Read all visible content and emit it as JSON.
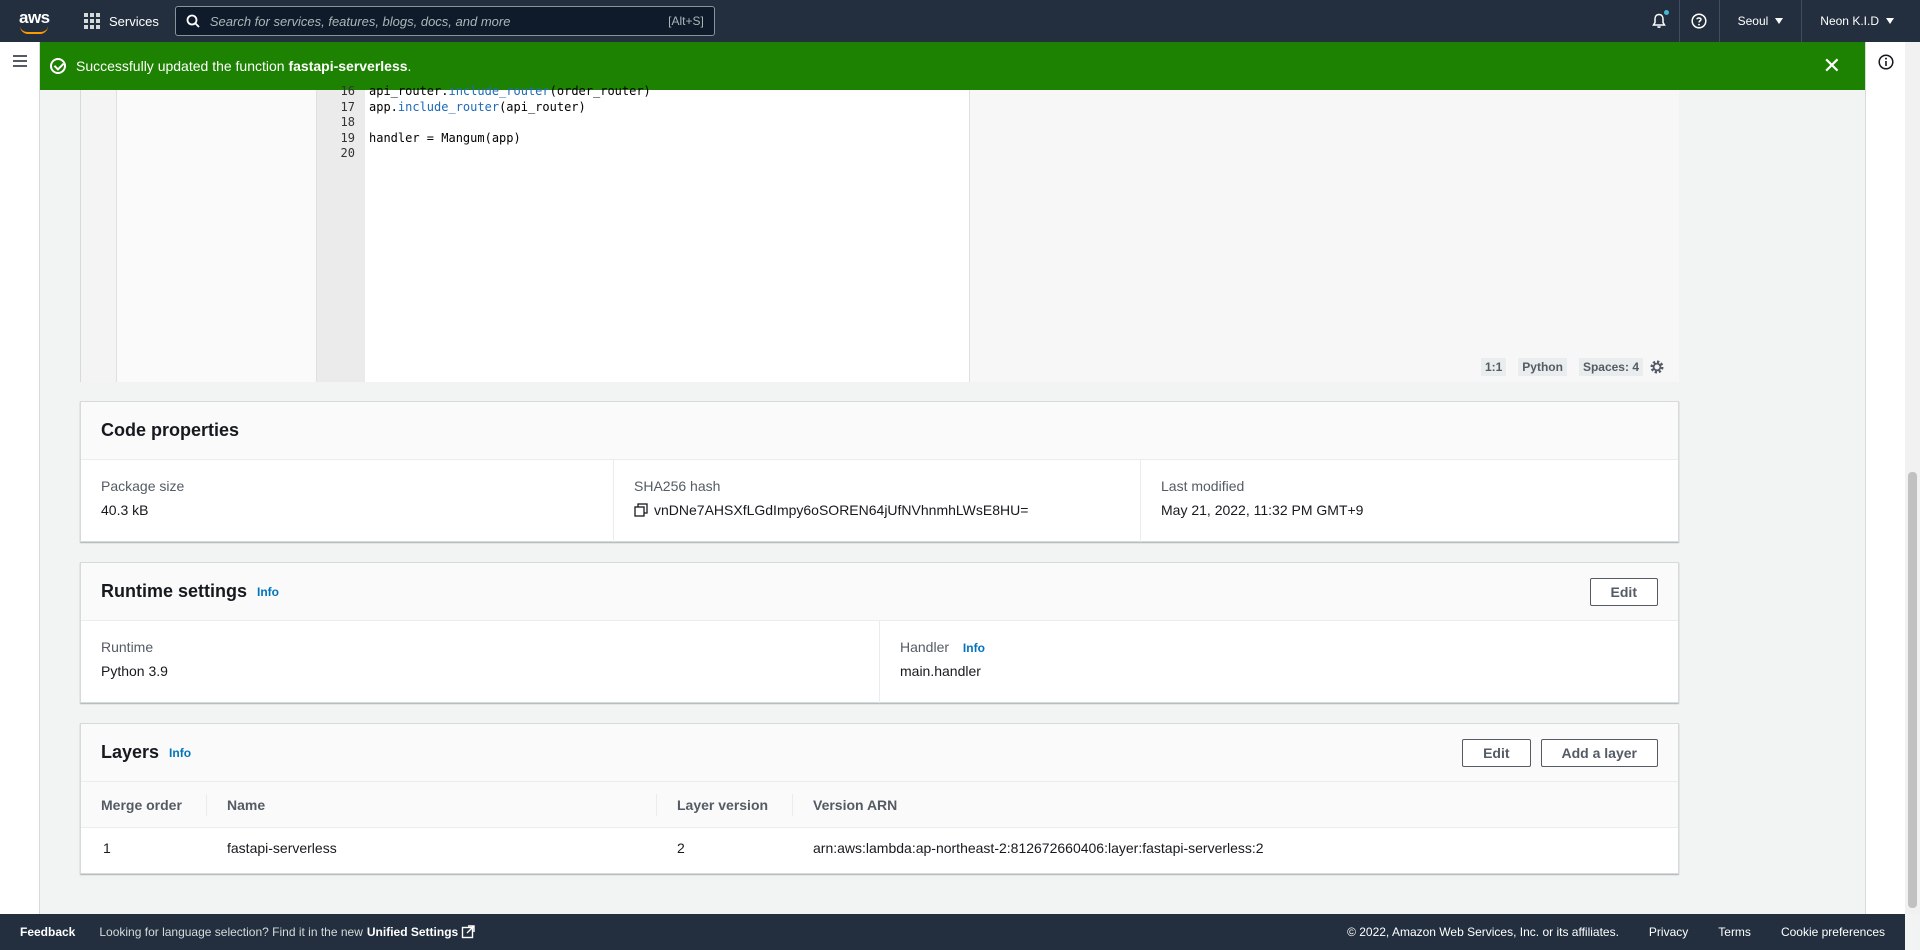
{
  "topnav": {
    "logo_text": "aws",
    "services_label": "Services",
    "search_placeholder": "Search for services, features, blogs, docs, and more",
    "search_shortcut": "[Alt+S]",
    "region_label": "Seoul",
    "account_label": "Neon K.I.D"
  },
  "flash": {
    "message_prefix": "Successfully updated the function ",
    "function_name": "fastapi-serverless",
    "message_suffix": ".",
    "color": "#1d8102"
  },
  "editor": {
    "line_numbers": [
      "16",
      "17",
      "18",
      "19",
      "20"
    ],
    "lines": [
      {
        "pre": "api_router.",
        "fn": "include_router",
        "post": "(order_router)"
      },
      {
        "pre": "app.",
        "fn": "include_router",
        "post": "(api_router)"
      },
      {
        "pre": "",
        "fn": "",
        "post": ""
      },
      {
        "pre": "handler = Mangum(app)",
        "fn": "",
        "post": ""
      },
      {
        "pre": "",
        "fn": "",
        "post": ""
      }
    ],
    "status": {
      "cursor": "1:1",
      "language": "Python",
      "spaces": "Spaces: 4"
    }
  },
  "code_properties": {
    "title": "Code properties",
    "package_size_label": "Package size",
    "package_size_value": "40.3 kB",
    "sha_label": "SHA256 hash",
    "sha_value": "vnDNe7AHSXfLGdImpy6oSOREN64jUfNVhnmhLWsE8HU=",
    "modified_label": "Last modified",
    "modified_value": "May 21, 2022, 11:32 PM GMT+9"
  },
  "runtime_settings": {
    "title": "Runtime settings",
    "info_label": "Info",
    "edit_label": "Edit",
    "runtime_label": "Runtime",
    "runtime_value": "Python 3.9",
    "handler_label": "Handler",
    "handler_info": "Info",
    "handler_value": "main.handler"
  },
  "layers": {
    "title": "Layers",
    "info_label": "Info",
    "edit_label": "Edit",
    "add_label": "Add a layer",
    "columns": [
      "Merge order",
      "Name",
      "Layer version",
      "Version ARN"
    ],
    "rows": [
      {
        "merge_order": "1",
        "name": "fastapi-serverless",
        "version": "2",
        "arn": "arn:aws:lambda:ap-northeast-2:812672660406:layer:fastapi-serverless:2"
      }
    ]
  },
  "footer": {
    "feedback": "Feedback",
    "language_text": "Looking for language selection? Find it in the new",
    "unified_settings": "Unified Settings",
    "copyright": "© 2022, Amazon Web Services, Inc. or its affiliates.",
    "privacy": "Privacy",
    "terms": "Terms",
    "cookie": "Cookie preferences"
  }
}
